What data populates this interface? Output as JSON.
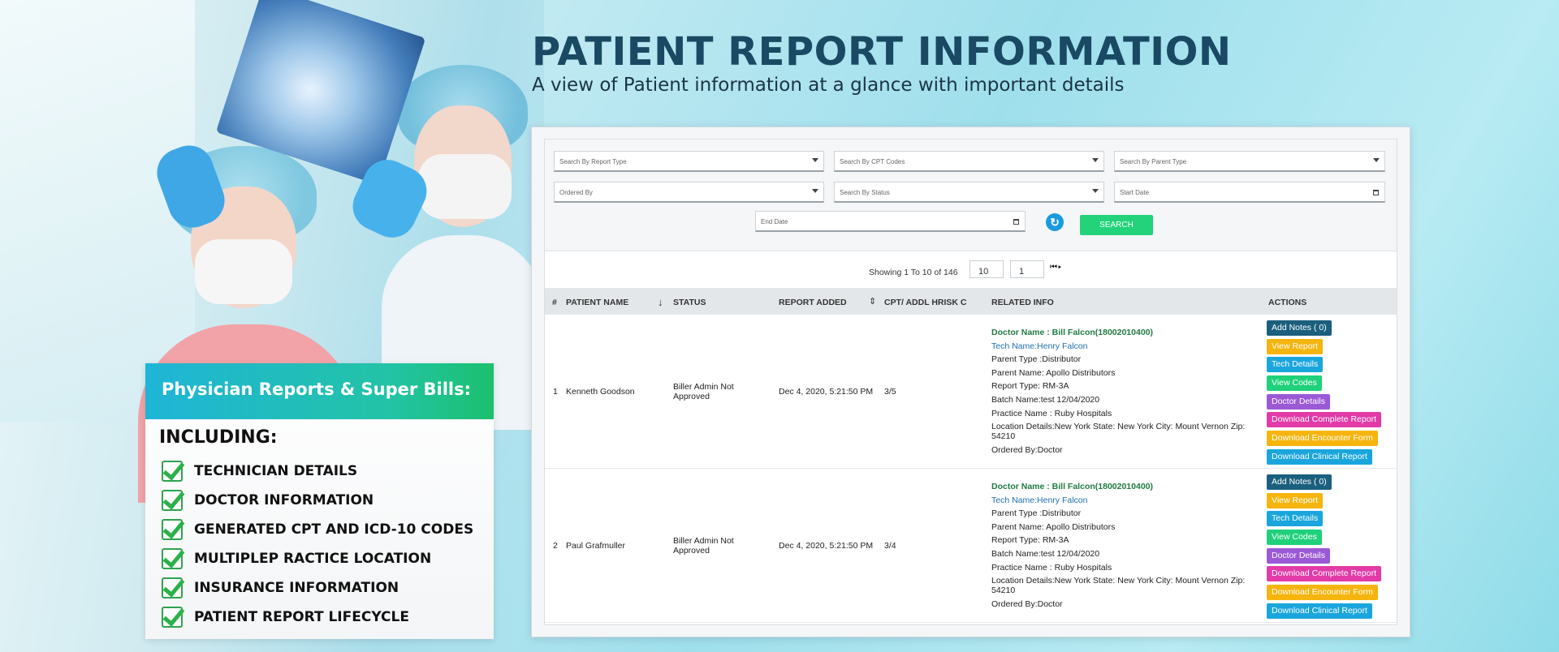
{
  "hero": {
    "title": "PATIENT REPORT INFORMATION",
    "subtitle": "A view of Patient information at a glance with important details"
  },
  "feature_card": {
    "heading": "Physician Reports & Super Bills:",
    "including": "INCLUDING:",
    "items": [
      "TECHNICIAN DETAILS",
      "DOCTOR INFORMATION",
      "GENERATED CPT AND ICD-10 CODES",
      "MULTIPLEP RACTICE LOCATION",
      "INSURANCE INFORMATION",
      "PATIENT REPORT LIFECYCLE"
    ]
  },
  "filters": {
    "report_type": "Search By Report Type",
    "cpt_codes": "Search By CPT Codes",
    "parent_type": "Search By Parent Type",
    "ordered_by": "Ordered By",
    "status": "Search By Status",
    "start_date": "Start Date",
    "end_date": "End Date",
    "search_label": "SEARCH"
  },
  "pager": {
    "showing": "Showing 1 To 10 of 146",
    "page_size": "10",
    "page": "1",
    "nav": "⏮▸"
  },
  "table": {
    "headers": {
      "num": "#",
      "patient_name": "PATIENT NAME",
      "status": "STATUS",
      "report_added": "REPORT ADDED",
      "cpt": "CPT/ ADDL HRISK C",
      "related": "RELATED INFO",
      "actions": "ACTIONS"
    },
    "rows": [
      {
        "num": "1",
        "patient_name": "Kenneth Goodson",
        "status": "Biller Admin Not Approved",
        "report_added": "Dec 4, 2020, 5:21:50 PM",
        "cpt": "3/5",
        "doctor": "Doctor Name : Bill Falcon(18002010400)",
        "tech": "Tech Name:Henry Falcon",
        "parent_type": "Parent Type :Distributor",
        "parent_name": "Parent Name: Apollo Distributors",
        "report_type": "Report Type: RM-3A",
        "batch": "Batch Name:test 12/04/2020",
        "practice": "Practice Name : Ruby Hospitals",
        "location": "Location Details:New York State: New York City: Mount Vernon Zip: 54210",
        "ordered_by": "Ordered By:Doctor"
      },
      {
        "num": "2",
        "patient_name": "Paul Grafmuller",
        "status": "Biller Admin Not Approved",
        "report_added": "Dec 4, 2020, 5:21:50 PM",
        "cpt": "3/4",
        "doctor": "Doctor Name : Bill Falcon(18002010400)",
        "tech": "Tech Name:Henry Falcon",
        "parent_type": "Parent Type :Distributor",
        "parent_name": "Parent Name: Apollo Distributors",
        "report_type": "Report Type: RM-3A",
        "batch": "Batch Name:test 12/04/2020",
        "practice": "Practice Name : Ruby Hospitals",
        "location": "Location Details:New York State: New York City: Mount Vernon Zip: 54210",
        "ordered_by": "Ordered By:Doctor"
      }
    ],
    "actions": [
      {
        "label": "Add Notes ( 0)",
        "color": "#1b5f7e"
      },
      {
        "label": "View Report",
        "color": "#f5b50e"
      },
      {
        "label": "Tech Details",
        "color": "#1aa6dd"
      },
      {
        "label": "View Codes",
        "color": "#1fd17a"
      },
      {
        "label": "Doctor Details",
        "color": "#9b59d6"
      },
      {
        "label": "Download Complete Report",
        "color": "#e23ba8"
      },
      {
        "label": "Download Encounter Form",
        "color": "#f5b50e"
      },
      {
        "label": "Download Clinical Report",
        "color": "#1aa6dd"
      }
    ]
  },
  "colors": {
    "title": "#1a4a63",
    "search_button": "#22d37b",
    "refresh": "#1a9be0"
  },
  "icons": {
    "dropdown": "chevron-down-icon",
    "calendar": "calendar-icon",
    "refresh": "refresh-icon",
    "check": "checkbox-checked-icon",
    "sort": "sort-icon"
  }
}
